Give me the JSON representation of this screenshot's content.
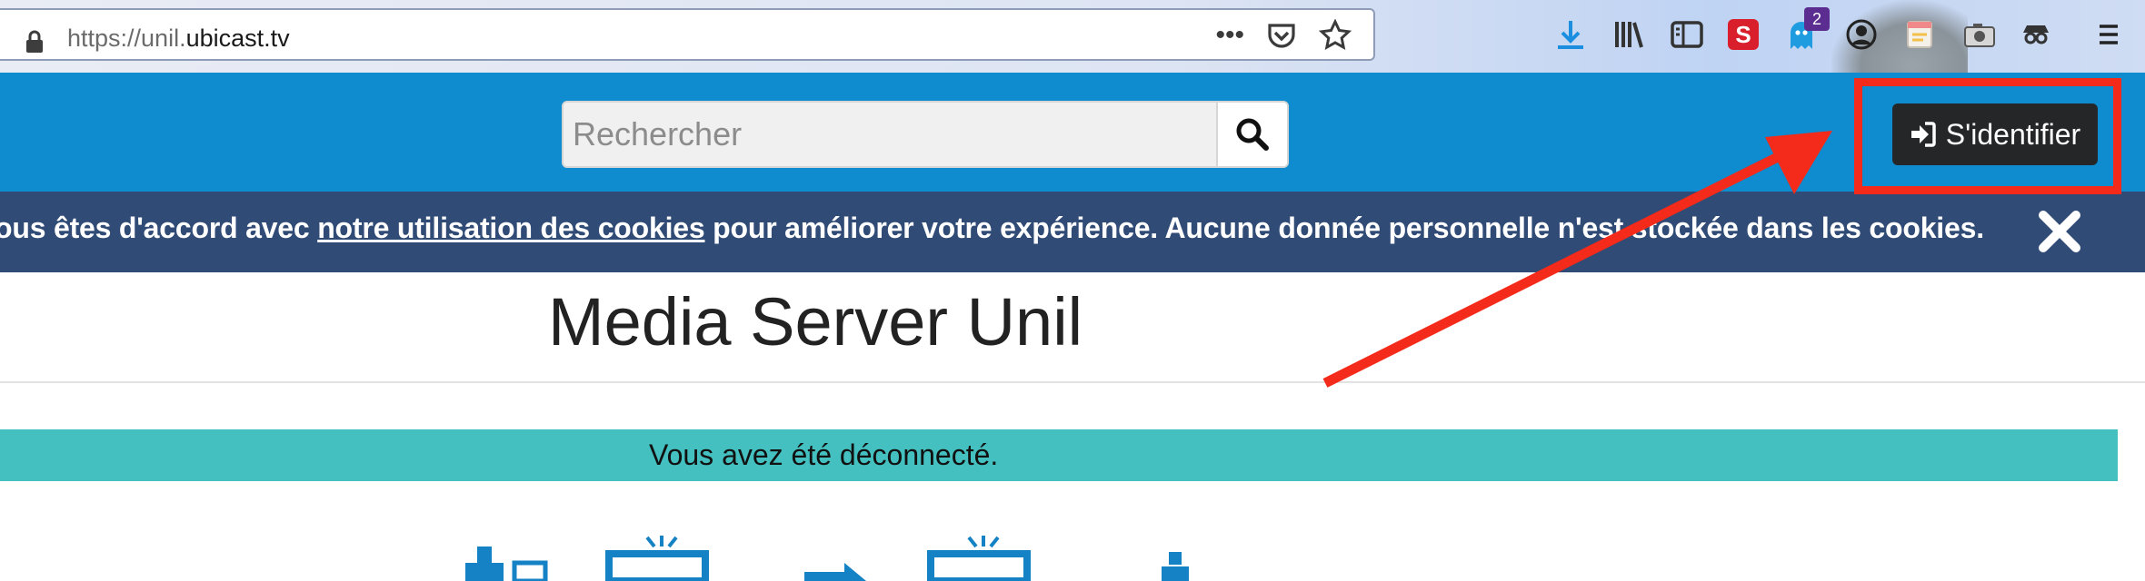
{
  "browser": {
    "url_prefix": "https://unil.",
    "url_domain": "ubicast.tv",
    "menu_dots": "•••",
    "extension_badge": "2",
    "icons": [
      "lock-icon",
      "pocket-icon",
      "bookmark-star-icon",
      "download-icon",
      "library-icon",
      "sidebar-icon",
      "extension-s-icon",
      "ghostery-icon",
      "avatar-extension-icon",
      "notes-icon",
      "camera-icon",
      "spy-icon",
      "hamburger-menu-icon"
    ]
  },
  "header": {
    "search_placeholder": "Rechercher",
    "login_label": "S'identifier",
    "colors": {
      "header_bg": "#0e8ccf",
      "button_bg": "#252628"
    }
  },
  "cookie_banner": {
    "text_before": "ous êtes d'accord avec ",
    "link_text": "notre utilisation des cookies",
    "text_after": " pour améliorer votre expérience. Aucune donnée personnelle n'est stockée dans les cookies.",
    "bg_color": "#304b76"
  },
  "page": {
    "title": "Media Server Unil"
  },
  "alert": {
    "message": "Vous avez été déconnecté.",
    "bg_color": "#43c0bf"
  },
  "annotation": {
    "color": "#f42a1a"
  }
}
